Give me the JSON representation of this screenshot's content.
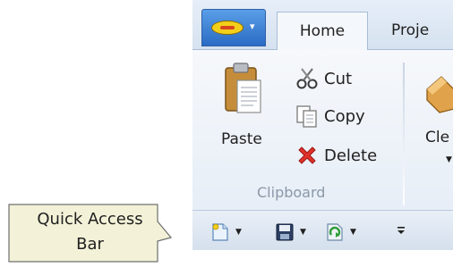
{
  "tabs": {
    "home": "Home",
    "project": "Proje"
  },
  "clipboard": {
    "paste_label": "Paste",
    "cut_label": "Cut",
    "copy_label": "Copy",
    "delete_label": "Delete",
    "group_label": "Clipboard"
  },
  "next_group": {
    "clear_label": "Cle"
  },
  "quick_access": {
    "buttons": [
      "new-doc-icon",
      "save-icon",
      "refresh-icon"
    ],
    "customize_icon": "customize-qat-icon"
  },
  "callout": {
    "line1": "Quick Access",
    "line2": "Bar"
  },
  "colors": {
    "accent": "#2a6bc4",
    "ribbon_bg": "#f4f7fb",
    "callout_fill": "#f3f2d8"
  }
}
